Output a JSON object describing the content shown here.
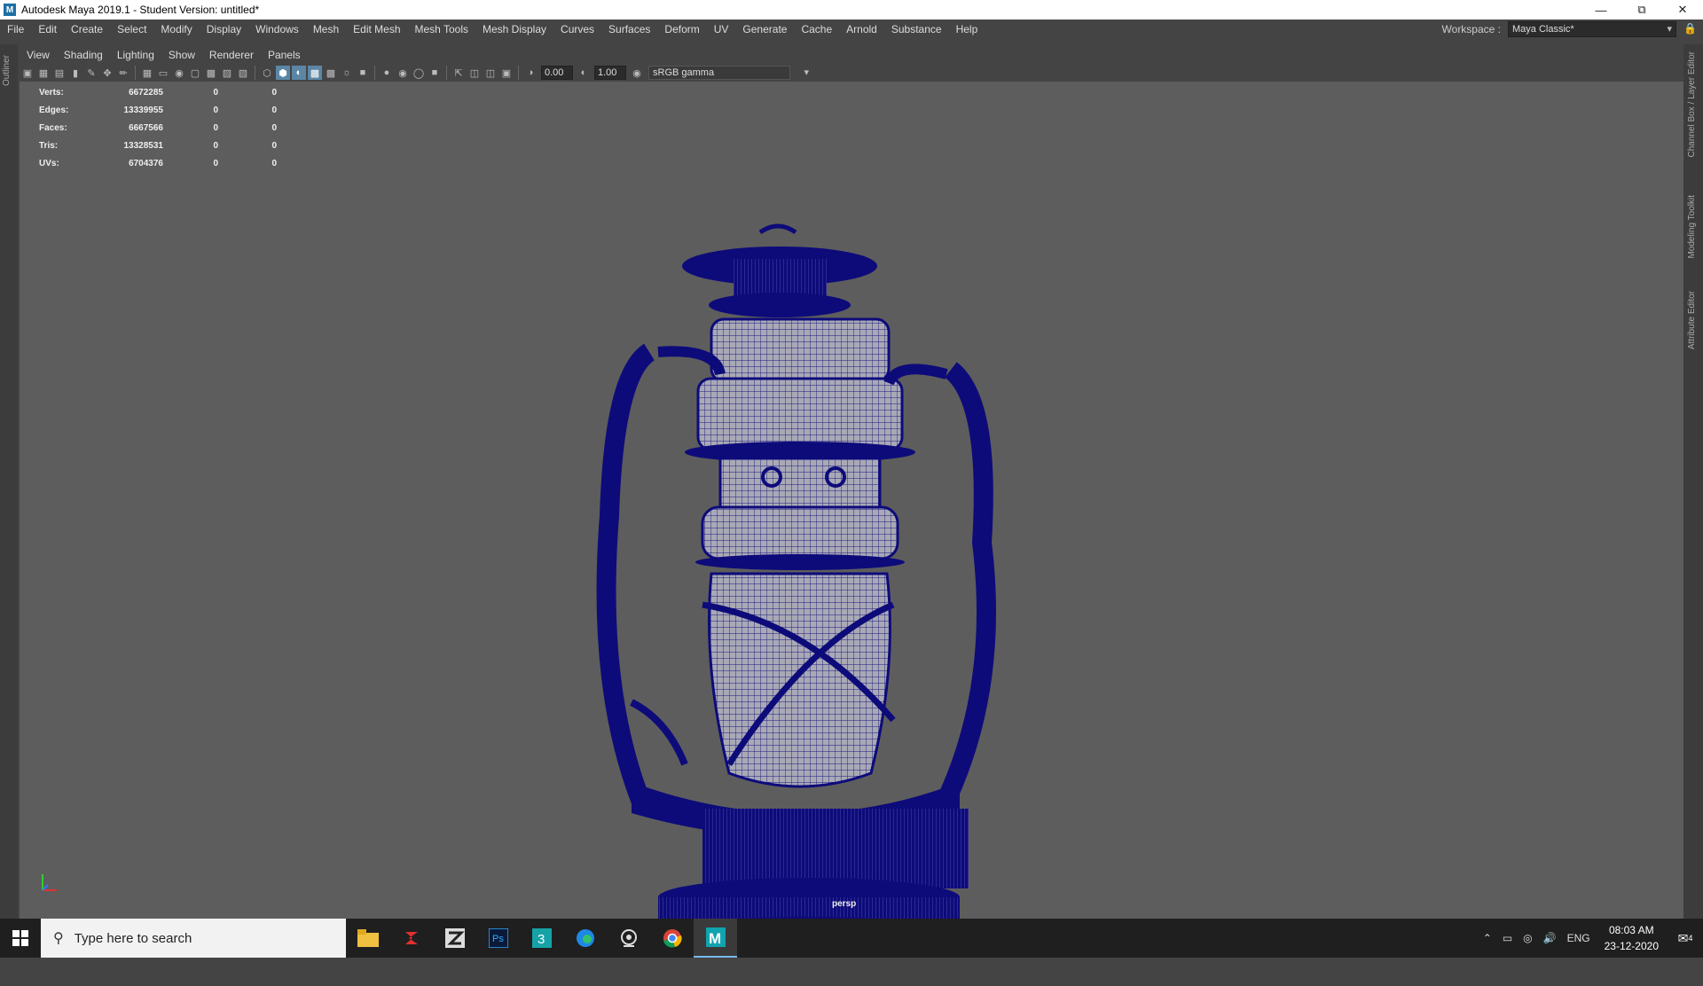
{
  "window": {
    "title": "Autodesk Maya 2019.1 - Student Version: untitled*"
  },
  "menu": [
    "File",
    "Edit",
    "Create",
    "Select",
    "Modify",
    "Display",
    "Windows",
    "Mesh",
    "Edit Mesh",
    "Mesh Tools",
    "Mesh Display",
    "Curves",
    "Surfaces",
    "Deform",
    "UV",
    "Generate",
    "Cache",
    "Arnold",
    "Substance",
    "Help"
  ],
  "workspace": {
    "label": "Workspace :",
    "value": "Maya Classic*"
  },
  "left_strip": {
    "outliner": "Outliner"
  },
  "right_strip": {
    "channel_box": "Channel Box / Layer Editor",
    "modeling_toolkit": "Modeling Toolkit",
    "attribute_editor": "Attribute Editor"
  },
  "panel_menu": [
    "View",
    "Shading",
    "Lighting",
    "Show",
    "Renderer",
    "Panels"
  ],
  "toolbar": {
    "exposure": "0.00",
    "gamma": "1.00",
    "color_space": "sRGB gamma"
  },
  "hud": {
    "rows": [
      {
        "label": "Verts:",
        "v1": "6672285",
        "v2": "0",
        "v3": "0"
      },
      {
        "label": "Edges:",
        "v1": "13339955",
        "v2": "0",
        "v3": "0"
      },
      {
        "label": "Faces:",
        "v1": "6667566",
        "v2": "0",
        "v3": "0"
      },
      {
        "label": "Tris:",
        "v1": "13328531",
        "v2": "0",
        "v3": "0"
      },
      {
        "label": "UVs:",
        "v1": "6704376",
        "v2": "0",
        "v3": "0"
      }
    ]
  },
  "viewport": {
    "camera": "persp",
    "background": "#5d5d5d",
    "wire_color": "#0d0b7a"
  },
  "taskbar": {
    "search_placeholder": "Type here to search",
    "lang": "ENG",
    "time": "08:03 AM",
    "date": "23-12-2020",
    "notifications": "4"
  }
}
